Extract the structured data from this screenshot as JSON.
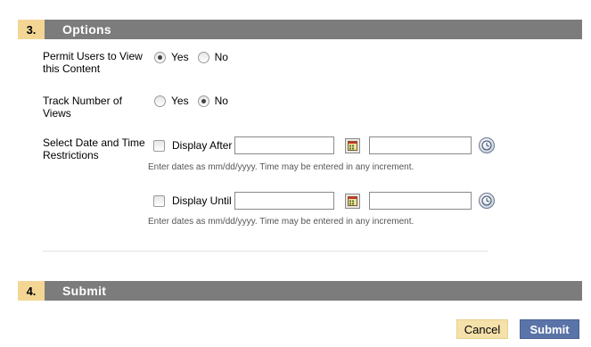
{
  "options_section": {
    "number": "3.",
    "title": "Options",
    "permit": {
      "label": "Permit Users to View this Content",
      "yes_label": "Yes",
      "no_label": "No",
      "selected": "Yes"
    },
    "track": {
      "label": "Track Number of Views",
      "yes_label": "Yes",
      "no_label": "No",
      "selected": "No"
    },
    "date_restrictions": {
      "label": "Select Date and Time Restrictions",
      "display_after": {
        "label": "Display After",
        "checked": false,
        "date_value": "",
        "time_value": "",
        "hint": "Enter dates as mm/dd/yyyy. Time may be entered in any increment."
      },
      "display_until": {
        "label": "Display Until",
        "checked": false,
        "date_value": "",
        "time_value": "",
        "hint": "Enter dates as mm/dd/yyyy. Time may be entered in any increment."
      }
    }
  },
  "submit_section": {
    "number": "4.",
    "title": "Submit",
    "cancel_label": "Cancel",
    "submit_label": "Submit"
  },
  "icons": {
    "calendar": "calendar-icon",
    "clock": "clock-icon"
  },
  "colors": {
    "header_bg": "#7c7c7c",
    "step_badge_bg": "#f4d694",
    "submit_bg": "#5a73a8",
    "cancel_bg": "#f5e1aa"
  }
}
